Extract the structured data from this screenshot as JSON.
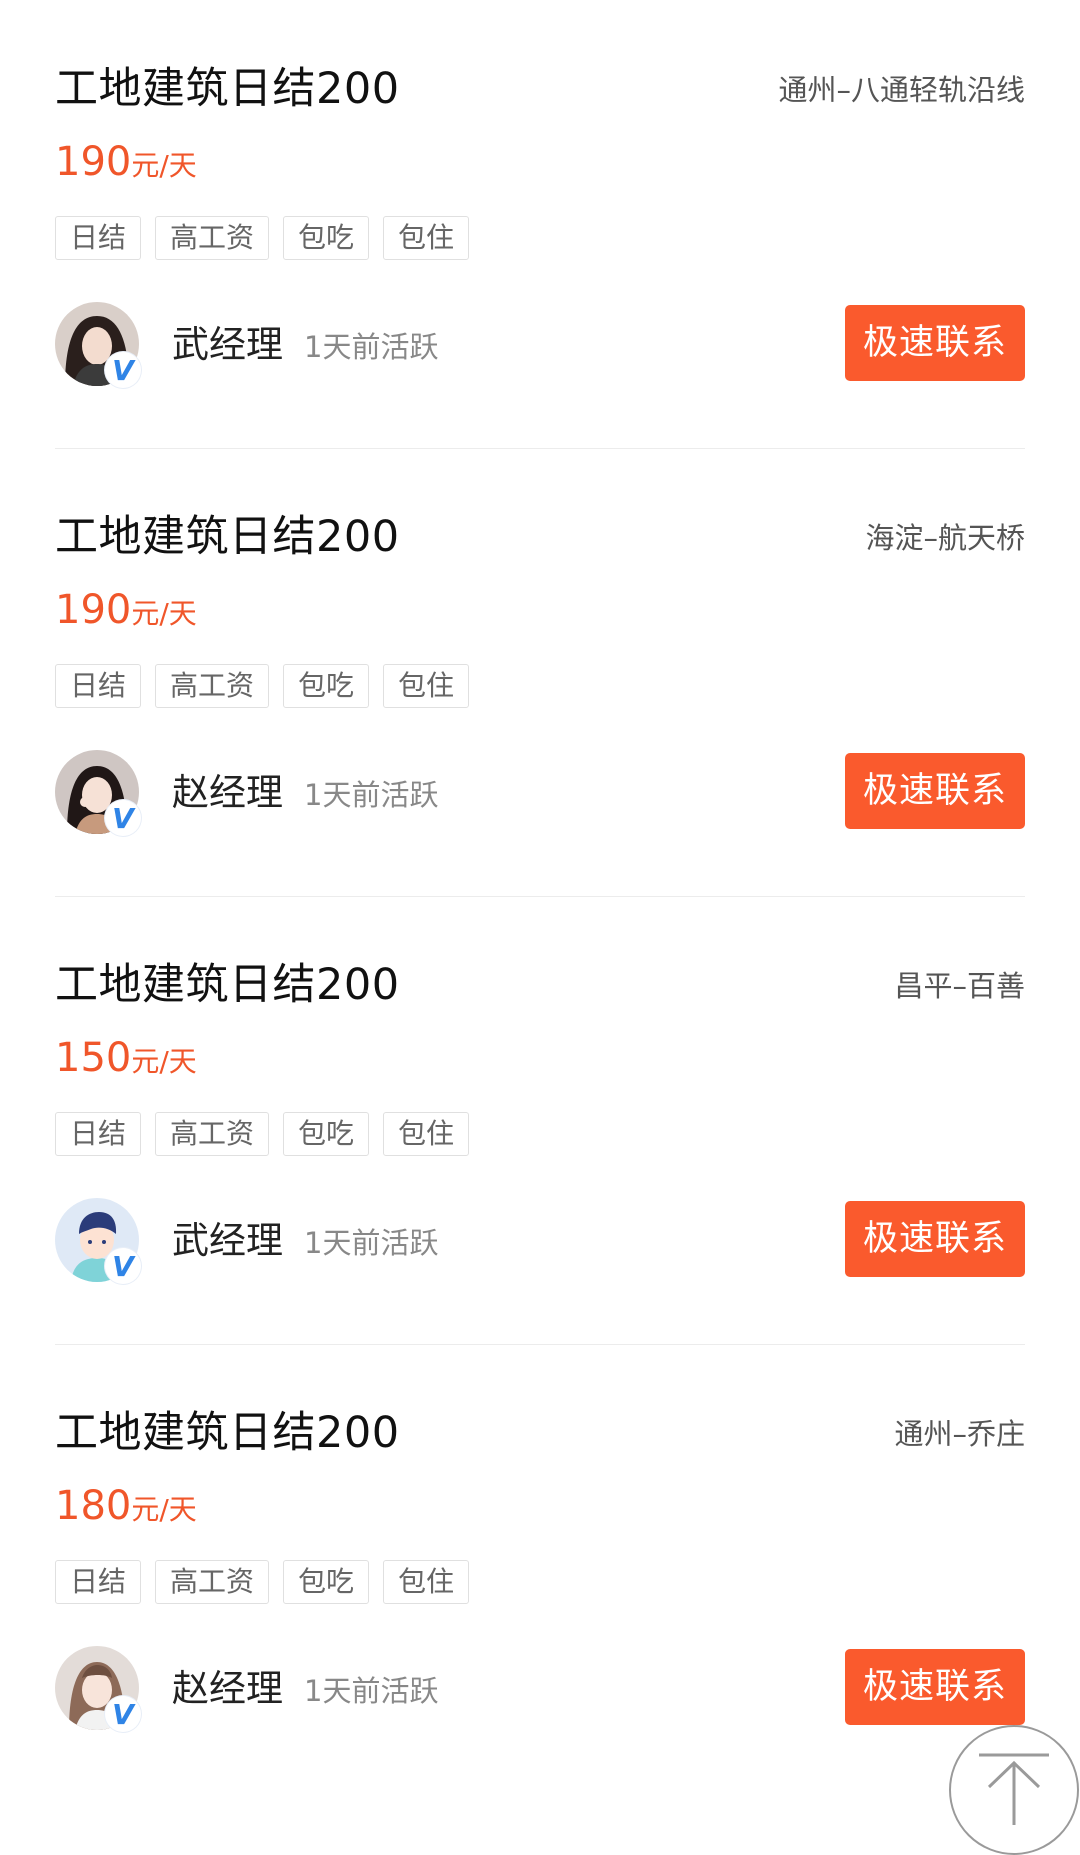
{
  "jobs": [
    {
      "title": "工地建筑日结200",
      "location": "通州–八通轻轨沿线",
      "salary_amount": "190",
      "salary_unit": "元/天",
      "tags": [
        "日结",
        "高工资",
        "包吃",
        "包住"
      ],
      "manager": "武经理",
      "active": "1天前活跃",
      "contact_label": "极速联系",
      "verified_badge": "V"
    },
    {
      "title": "工地建筑日结200",
      "location": "海淀–航天桥",
      "salary_amount": "190",
      "salary_unit": "元/天",
      "tags": [
        "日结",
        "高工资",
        "包吃",
        "包住"
      ],
      "manager": "赵经理",
      "active": "1天前活跃",
      "contact_label": "极速联系",
      "verified_badge": "V"
    },
    {
      "title": "工地建筑日结200",
      "location": "昌平–百善",
      "salary_amount": "150",
      "salary_unit": "元/天",
      "tags": [
        "日结",
        "高工资",
        "包吃",
        "包住"
      ],
      "manager": "武经理",
      "active": "1天前活跃",
      "contact_label": "极速联系",
      "verified_badge": "V"
    },
    {
      "title": "工地建筑日结200",
      "location": "通州–乔庄",
      "salary_amount": "180",
      "salary_unit": "元/天",
      "tags": [
        "日结",
        "高工资",
        "包吃",
        "包住"
      ],
      "manager": "赵经理",
      "active": "1天前活跃",
      "contact_label": "极速联系",
      "verified_badge": "V"
    }
  ],
  "colors": {
    "accent": "#fa5a2d",
    "salary": "#f0562a",
    "badge": "#2f84e6"
  },
  "icons": {
    "back_to_top": "arrow-up-to-line-icon"
  }
}
